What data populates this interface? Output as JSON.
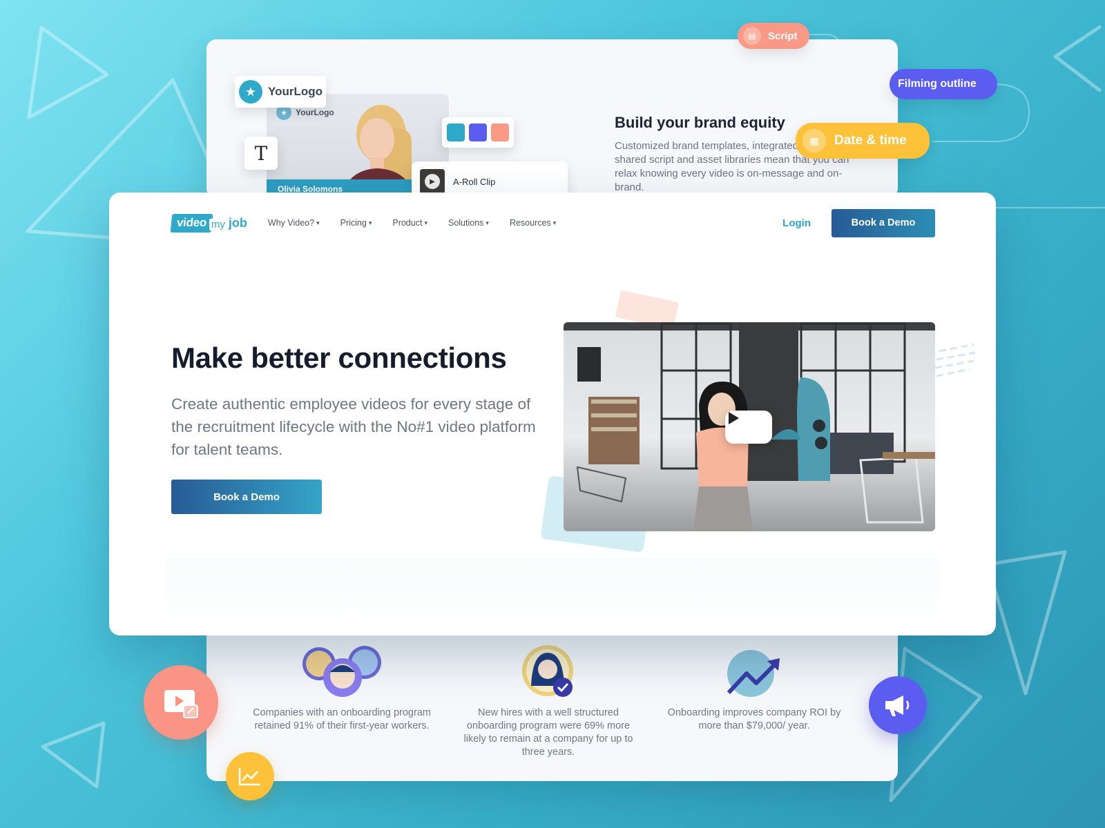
{
  "brand_card": {
    "logo_chip": "YourLogo",
    "mini_logo": "YourLogo",
    "person_name": "Olivia Solomons",
    "text_tool_glyph": "T",
    "swatches": [
      "#2fa9c9",
      "#5b5cf0",
      "#fa9a86"
    ],
    "aroll_label": "A-Roll Clip",
    "title": "Build your brand equity",
    "description": "Customized brand templates, integrated channels, shared script and asset libraries mean that you can relax knowing every video is on-message and on-brand."
  },
  "pills": {
    "script": "Script",
    "filming": "Filming outline",
    "date": "Date & time"
  },
  "nav": {
    "logo_video": "video",
    "logo_my": "my",
    "logo_job": "job",
    "items": [
      "Why Video?",
      "Pricing",
      "Product",
      "Solutions",
      "Resources"
    ],
    "login": "Login",
    "cta": "Book a Demo"
  },
  "hero": {
    "title": "Make better connections",
    "subtitle": "Create authentic employee videos for every stage of the recruitment lifecycle with the No#1 video platform for talent teams.",
    "cta": "Book a Demo"
  },
  "stats": [
    {
      "text": "Companies with an onboarding program retained 91% of their first-year workers."
    },
    {
      "text": "New hires with a well structured onboarding program were 69% more likely to remain at a company for up to three years."
    },
    {
      "text": "Onboarding improves company ROI by more than $79,000/ year."
    }
  ],
  "icons": {
    "video_edit": "video-edit-icon",
    "chart": "chart-icon",
    "megaphone": "megaphone-icon",
    "play": "play-icon",
    "star": "star-icon",
    "script": "document-icon",
    "calendar": "calendar-icon"
  },
  "colors": {
    "accent": "#2fa9c9",
    "cta_start": "#275b95",
    "cta_end": "#35a4c7",
    "coral": "#fa9586",
    "violet": "#5b5cf0",
    "yellow": "#fdc23a"
  }
}
